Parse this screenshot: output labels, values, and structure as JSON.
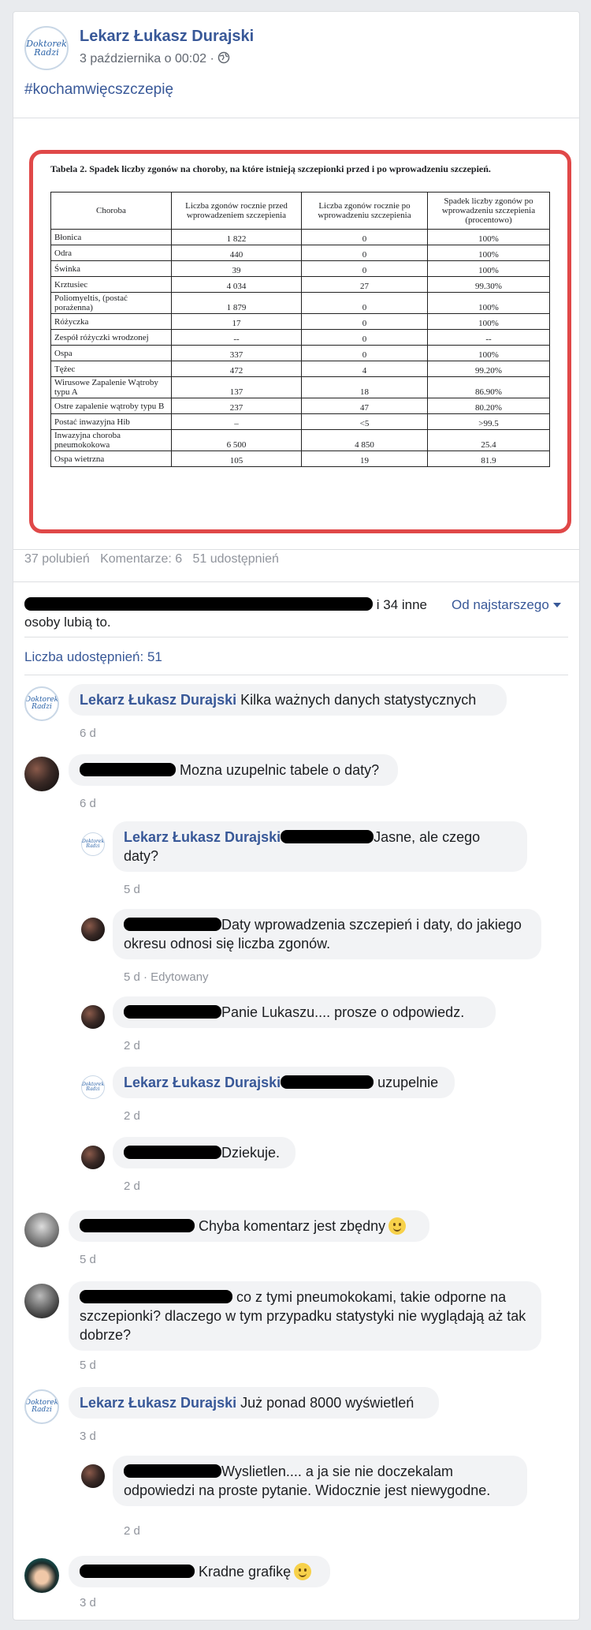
{
  "post": {
    "author": "Lekarz Łukasz Durajski",
    "timestamp": "3 października o 00:02 ·",
    "hashtag": "#kochamwięcszczepię",
    "avatar_logo_text": "Doktorek Radzi"
  },
  "table": {
    "title": "Tabela 2. Spadek liczby zgonów na choroby, na które istnieją szczepionki przed i po wprowadzeniu szczepień.",
    "headers": [
      "Choroba",
      "Liczba zgonów rocznie przed wprowadzeniem szczepienia",
      "Liczba zgonów rocznie po wprowadzeniu szczepienia",
      "Spadek liczby zgonów po wprowadzeniu szczepienia (procentowo)"
    ],
    "rows": [
      [
        "Błonica",
        "1 822",
        "0",
        "100%"
      ],
      [
        "Odra",
        "440",
        "0",
        "100%"
      ],
      [
        "Świnka",
        "39",
        "0",
        "100%"
      ],
      [
        "Krztusiec",
        "4 034",
        "27",
        "99.30%"
      ],
      [
        "Poliomyeltis, (postać porażenna)",
        "1 879",
        "0",
        "100%"
      ],
      [
        "Różyczka",
        "17",
        "0",
        "100%"
      ],
      [
        "Zespół różyczki wrodzonej",
        "--",
        "0",
        "--"
      ],
      [
        "Ospa",
        "337",
        "0",
        "100%"
      ],
      [
        "Tężec",
        "472",
        "4",
        "99.20%"
      ],
      [
        "Wirusowe Zapalenie Wątroby typu A",
        "137",
        "18",
        "86.90%"
      ],
      [
        "Ostre zapalenie wątroby typu B",
        "237",
        "47",
        "80.20%"
      ],
      [
        "Postać inwazyjna Hib",
        "–",
        "<5",
        ">99.5"
      ],
      [
        "Inwazyjna choroba pneumokokowa",
        "6 500",
        "4 850",
        "25.4"
      ],
      [
        "Ospa wietrzna",
        "105",
        "19",
        "81.9"
      ]
    ]
  },
  "stats": {
    "likes": "37 polubień",
    "comments": "Komentarze: 6",
    "shares": "51 udostępnień",
    "likers_suffix": "i 34 inne",
    "likers_line2": "osoby lubią to.",
    "sort_label": "Od najstarszego",
    "share_count_link": "Liczba udostępnień: 51"
  },
  "comments": [
    {
      "author": "Lekarz Łukasz Durajski",
      "text": "Kilka ważnych danych statystycznych",
      "time": "6 d"
    },
    {
      "author": "",
      "text": "Mozna uzupelnic tabele o daty?",
      "time": "6 d"
    },
    {
      "author": "Lekarz Łukasz Durajski",
      "text": "Jasne, ale czego daty?",
      "time": "5 d"
    },
    {
      "author": "",
      "text": "Daty wprowadzenia szczepień i daty, do jakiego okresu odnosi się liczba zgonów.",
      "time": "5 d · Edytowany"
    },
    {
      "author": "",
      "text": "Panie Lukaszu.... prosze o odpowiedz.",
      "time": "2 d"
    },
    {
      "author": "Lekarz Łukasz Durajski",
      "text": "uzupelnie",
      "time": "2 d"
    },
    {
      "author": "",
      "text": "Dziekuje.",
      "time": "2 d"
    },
    {
      "author": "",
      "text": "Chyba komentarz jest zbędny",
      "time": "5 d"
    },
    {
      "author": "",
      "text": "co z tymi pneumokokami, takie odporne na szczepionki? dlaczego w tym przypadku statystyki nie wyglądają aż tak dobrze?",
      "time": "5 d"
    },
    {
      "author": "Lekarz Łukasz Durajski",
      "text": "Już ponad 8000 wyświetleń",
      "time": "3 d"
    },
    {
      "author": "",
      "text": "Wyslietlen.... a ja sie nie doczekalam odpowiedzi na proste pytanie. Widocznie jest niewygodne.",
      "time": "2 d"
    },
    {
      "author": "",
      "text": "Kradne grafikę",
      "time": "3 d"
    }
  ],
  "colors": {
    "link": "#385898",
    "frame_red": "#e04848",
    "bubble_bg": "#f2f3f5",
    "page_bg": "#e9ebee"
  }
}
